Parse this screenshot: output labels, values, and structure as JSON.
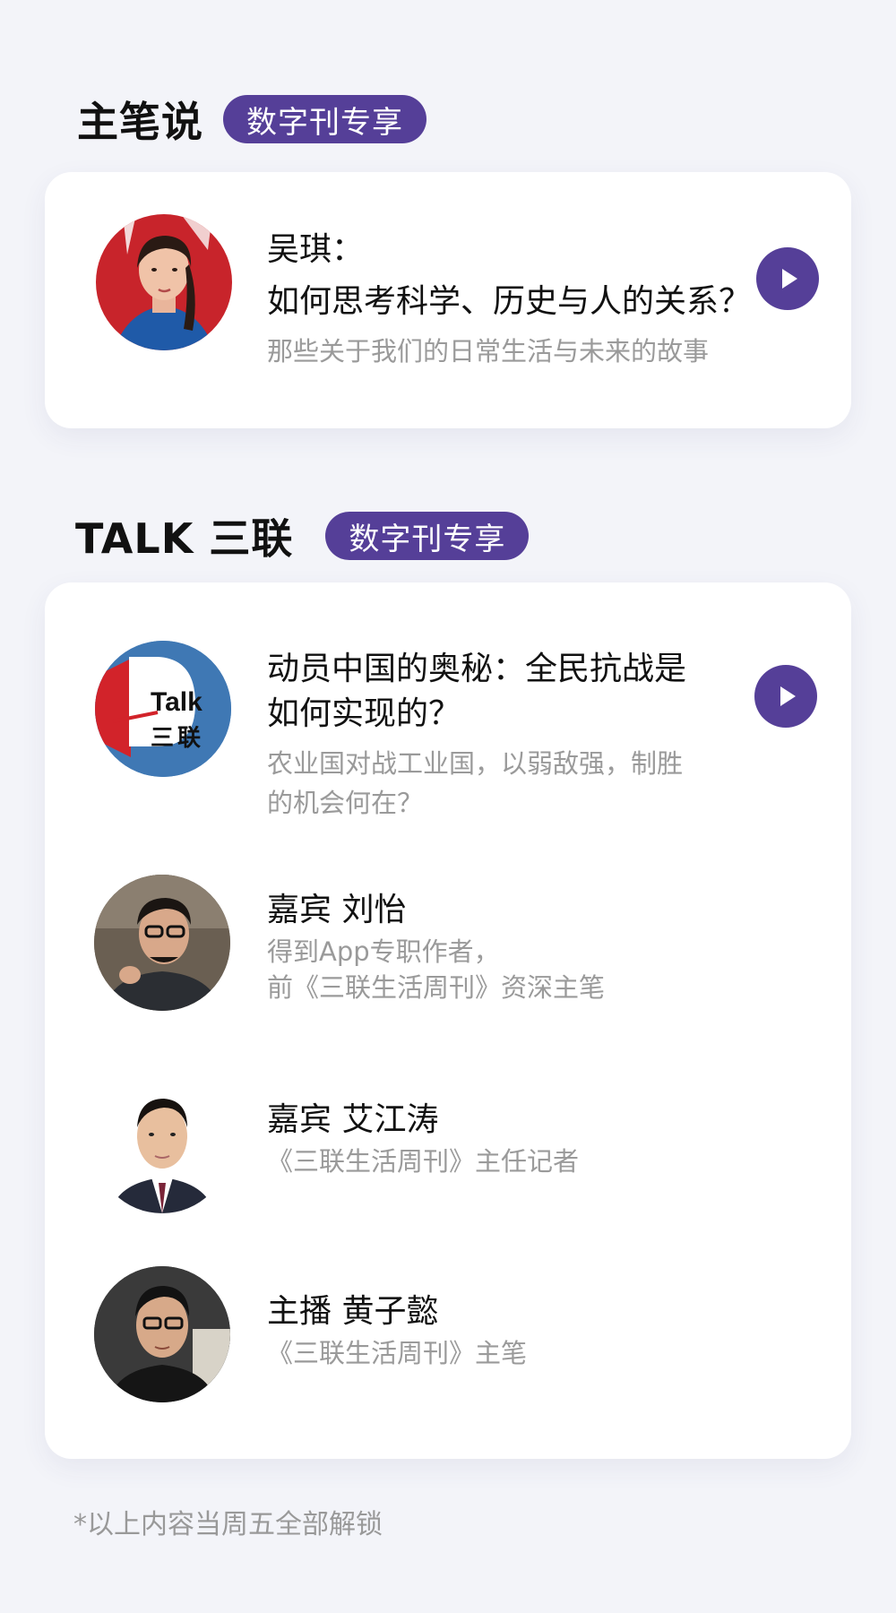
{
  "section1": {
    "title": "主笔说",
    "badge": "数字刊专享",
    "item": {
      "title_line1": "吴琪：",
      "title_line2": "如何思考科学、历史与人的关系？",
      "subtitle": "那些关于我们的日常生活与未来的故事"
    }
  },
  "section2": {
    "title": "TALK 三联",
    "badge": "数字刊专享",
    "episode": {
      "logo_text_top": "Talk",
      "logo_text_bottom": "三联",
      "title_line1": "动员中国的奥秘：全民抗战是",
      "title_line2": "如何实现的？",
      "subtitle_line1": "农业国对战工业国，以弱敌强，制胜",
      "subtitle_line2": "的机会何在？"
    },
    "people": [
      {
        "title": "嘉宾 刘怡",
        "desc_line1": "得到App专职作者，",
        "desc_line2": "前《三联生活周刊》资深主笔"
      },
      {
        "title": "嘉宾 艾江涛",
        "desc_line1": "《三联生活周刊》主任记者"
      },
      {
        "title": "主播 黄子懿",
        "desc_line1": "《三联生活周刊》主笔"
      }
    ]
  },
  "footnote": "*以上内容当周五全部解锁",
  "colors": {
    "accent": "#553f98",
    "background": "#f3f4f9"
  },
  "icons": {
    "play": "play-icon"
  }
}
